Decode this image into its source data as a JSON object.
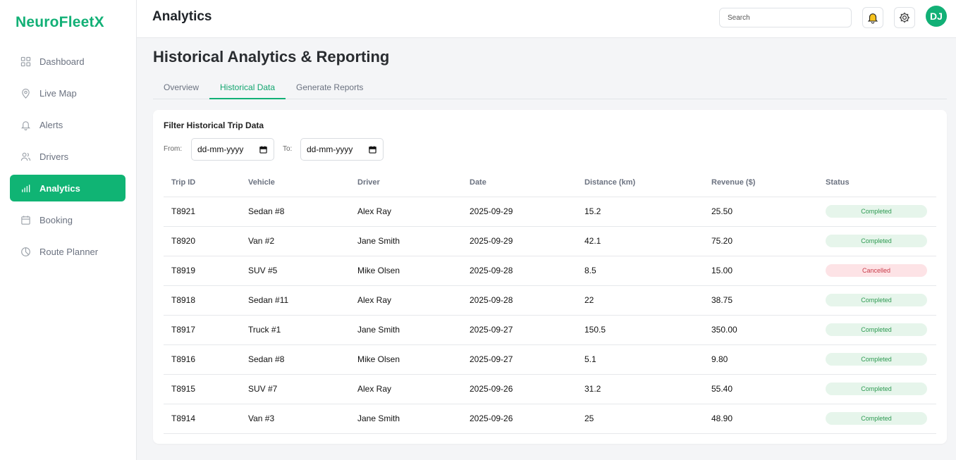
{
  "brand": "NeuroFleetX",
  "sidebar": {
    "items": [
      {
        "label": "Dashboard",
        "icon": "grid-icon",
        "active": false
      },
      {
        "label": "Live Map",
        "icon": "map-pin-icon",
        "active": false
      },
      {
        "label": "Alerts",
        "icon": "bell-icon",
        "active": false
      },
      {
        "label": "Drivers",
        "icon": "users-icon",
        "active": false
      },
      {
        "label": "Analytics",
        "icon": "bar-chart-icon",
        "active": true
      },
      {
        "label": "Booking",
        "icon": "calendar-icon",
        "active": false
      },
      {
        "label": "Route Planner",
        "icon": "pie-chart-icon",
        "active": false
      }
    ]
  },
  "header": {
    "title": "Analytics",
    "search_placeholder": "Search",
    "avatar_initials": "DJ"
  },
  "main": {
    "title": "Historical Analytics & Reporting",
    "tabs": [
      {
        "label": "Overview",
        "active": false
      },
      {
        "label": "Historical Data",
        "active": true
      },
      {
        "label": "Generate Reports",
        "active": false
      }
    ],
    "filter": {
      "title": "Filter Historical Trip Data",
      "from_label": "From:",
      "to_label": "To:",
      "from_value": "dd-mm-yyyy",
      "to_value": "dd-mm-yyyy"
    },
    "table": {
      "columns": [
        "Trip ID",
        "Vehicle",
        "Driver",
        "Date",
        "Distance (km)",
        "Revenue ($)",
        "Status"
      ],
      "rows": [
        {
          "id": "T8921",
          "vehicle": "Sedan #8",
          "driver": "Alex Ray",
          "date": "2025-09-29",
          "distance": "15.2",
          "revenue": "25.50",
          "status": "Completed"
        },
        {
          "id": "T8920",
          "vehicle": "Van #2",
          "driver": "Jane Smith",
          "date": "2025-09-29",
          "distance": "42.1",
          "revenue": "75.20",
          "status": "Completed"
        },
        {
          "id": "T8919",
          "vehicle": "SUV #5",
          "driver": "Mike Olsen",
          "date": "2025-09-28",
          "distance": "8.5",
          "revenue": "15.00",
          "status": "Cancelled"
        },
        {
          "id": "T8918",
          "vehicle": "Sedan #11",
          "driver": "Alex Ray",
          "date": "2025-09-28",
          "distance": "22",
          "revenue": "38.75",
          "status": "Completed"
        },
        {
          "id": "T8917",
          "vehicle": "Truck #1",
          "driver": "Jane Smith",
          "date": "2025-09-27",
          "distance": "150.5",
          "revenue": "350.00",
          "status": "Completed"
        },
        {
          "id": "T8916",
          "vehicle": "Sedan #8",
          "driver": "Mike Olsen",
          "date": "2025-09-27",
          "distance": "5.1",
          "revenue": "9.80",
          "status": "Completed"
        },
        {
          "id": "T8915",
          "vehicle": "SUV #7",
          "driver": "Alex Ray",
          "date": "2025-09-26",
          "distance": "31.2",
          "revenue": "55.40",
          "status": "Completed"
        },
        {
          "id": "T8914",
          "vehicle": "Van #3",
          "driver": "Jane Smith",
          "date": "2025-09-26",
          "distance": "25",
          "revenue": "48.90",
          "status": "Completed"
        }
      ]
    }
  },
  "colors": {
    "accent": "#10b474",
    "completed_bg": "#e6f5eb",
    "completed_text": "#2e9a52",
    "cancelled_bg": "#fde3e6",
    "cancelled_text": "#c83a48"
  }
}
